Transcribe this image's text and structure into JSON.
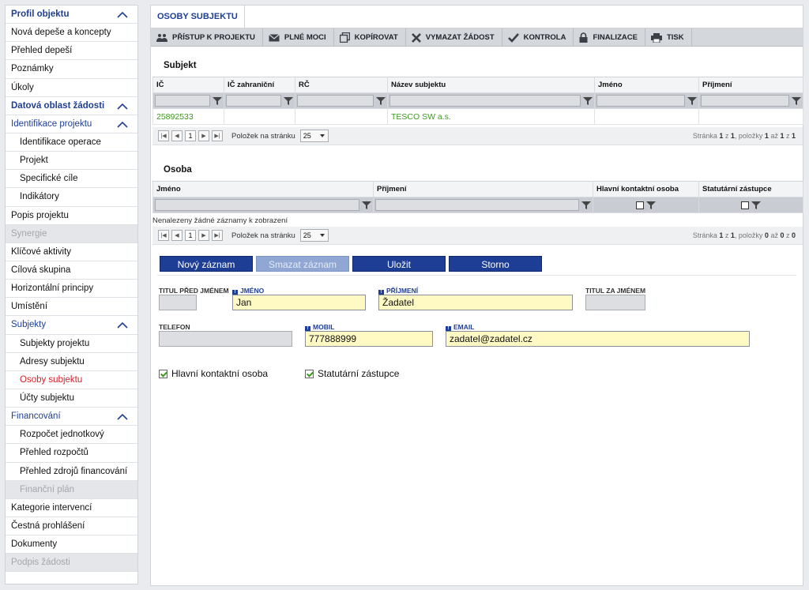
{
  "sidebar": {
    "items": [
      {
        "label": "Profil objektu",
        "type": "hdr",
        "chevron": true
      },
      {
        "label": "Nová depeše a koncepty",
        "type": "item"
      },
      {
        "label": "Přehled depeší",
        "type": "item"
      },
      {
        "label": "Poznámky",
        "type": "item"
      },
      {
        "label": "Úkoly",
        "type": "item"
      },
      {
        "label": "Datová oblast žádosti",
        "type": "hdr",
        "chevron": true
      },
      {
        "label": "Identifikace projektu",
        "type": "shdr",
        "chevron": true
      },
      {
        "label": "Identifikace operace",
        "type": "sub"
      },
      {
        "label": "Projekt",
        "type": "sub"
      },
      {
        "label": "Specifické cíle",
        "type": "sub"
      },
      {
        "label": "Indikátory",
        "type": "sub"
      },
      {
        "label": "Popis projektu",
        "type": "item"
      },
      {
        "label": "Synergie",
        "type": "dis"
      },
      {
        "label": "Klíčové aktivity",
        "type": "item"
      },
      {
        "label": "Cílová skupina",
        "type": "item"
      },
      {
        "label": "Horizontální principy",
        "type": "item"
      },
      {
        "label": "Umístění",
        "type": "item"
      },
      {
        "label": "Subjekty",
        "type": "shdr",
        "chevron": true
      },
      {
        "label": "Subjekty projektu",
        "type": "sub"
      },
      {
        "label": "Adresy subjektu",
        "type": "sub"
      },
      {
        "label": "Osoby subjektu",
        "type": "sub active"
      },
      {
        "label": "Účty subjektu",
        "type": "sub"
      },
      {
        "label": "Financování",
        "type": "shdr",
        "chevron": true
      },
      {
        "label": "Rozpočet jednotkový",
        "type": "sub"
      },
      {
        "label": "Přehled rozpočtů",
        "type": "sub"
      },
      {
        "label": "Přehled zdrojů financování",
        "type": "sub"
      },
      {
        "label": "Finanční plán",
        "type": "sub dis"
      },
      {
        "label": "Kategorie intervencí",
        "type": "item"
      },
      {
        "label": "Čestná prohlášení",
        "type": "item"
      },
      {
        "label": "Dokumenty",
        "type": "item"
      },
      {
        "label": "Podpis žádosti",
        "type": "dis"
      }
    ]
  },
  "tab": {
    "label": "OSOBY SUBJEKTU"
  },
  "toolbar": {
    "buttons": [
      {
        "label": "PŘÍSTUP K PROJEKTU",
        "icon": "people-icon"
      },
      {
        "label": "PLNÉ MOCI",
        "icon": "envelope-icon"
      },
      {
        "label": "KOPÍROVAT",
        "icon": "copy-icon"
      },
      {
        "label": "VYMAZAT ŽÁDOST",
        "icon": "x-icon"
      },
      {
        "label": "KONTROLA",
        "icon": "check-icon"
      },
      {
        "label": "FINALIZACE",
        "icon": "lock-icon"
      },
      {
        "label": "TISK",
        "icon": "printer-icon"
      }
    ]
  },
  "subjekt": {
    "title": "Subjekt",
    "columns": [
      "IČ",
      "IČ zahraniční",
      "RČ",
      "Název subjektu",
      "Jméno",
      "Příjmení"
    ],
    "rows": [
      [
        "25892533",
        "",
        "",
        "TESCO SW a.s.",
        "",
        ""
      ]
    ],
    "pager": {
      "page": "1",
      "per_page_label": "Položek na stránku",
      "per_page": "25",
      "info_prefix": "Stránka ",
      "page_no": "1",
      "info_of": " z ",
      "pages": "1",
      "info_items": ", položky ",
      "from": "1",
      "info_to": " až ",
      "to": "1",
      "info_z": " z ",
      "total": "1"
    }
  },
  "osoba": {
    "title": "Osoba",
    "columns": [
      "Jméno",
      "Příjmení",
      "Hlavní kontaktní osoba",
      "Statutární zástupce"
    ],
    "empty": "Nenalezeny žádné záznamy k zobrazení",
    "pager": {
      "page": "1",
      "per_page_label": "Položek na stránku",
      "per_page": "25",
      "info_prefix": "Stránka ",
      "page_no": "1",
      "info_of": " z ",
      "pages": "1",
      "info_items": ", položky ",
      "from": "0",
      "info_to": " až ",
      "to": "0",
      "info_z": " z ",
      "total": "0"
    }
  },
  "actions": {
    "new": "Nový záznam",
    "delete": "Smazat záznam",
    "save": "Uložit",
    "cancel": "Storno"
  },
  "form": {
    "titul_pred": {
      "label": "TITUL PŘED JMÉNEM",
      "value": ""
    },
    "jmeno": {
      "label": "JMÉNO",
      "value": "Jan"
    },
    "prijmeni": {
      "label": "PŘÍJMENÍ",
      "value": "Žadatel"
    },
    "titul_za": {
      "label": "TITUL ZA JMÉNEM",
      "value": ""
    },
    "telefon": {
      "label": "TELEFON",
      "value": ""
    },
    "mobil": {
      "label": "MOBIL",
      "value": "777888999"
    },
    "email": {
      "label": "EMAIL",
      "value": "zadatel@zadatel.cz"
    },
    "hlavni": {
      "label": "Hlavní kontaktní osoba",
      "checked": true
    },
    "statutarni": {
      "label": "Statutární zástupce",
      "checked": true
    },
    "req_mark": "!"
  },
  "colors": {
    "accent": "#1e3d94",
    "active": "#d2232a",
    "link_green": "#3d9a1e"
  }
}
